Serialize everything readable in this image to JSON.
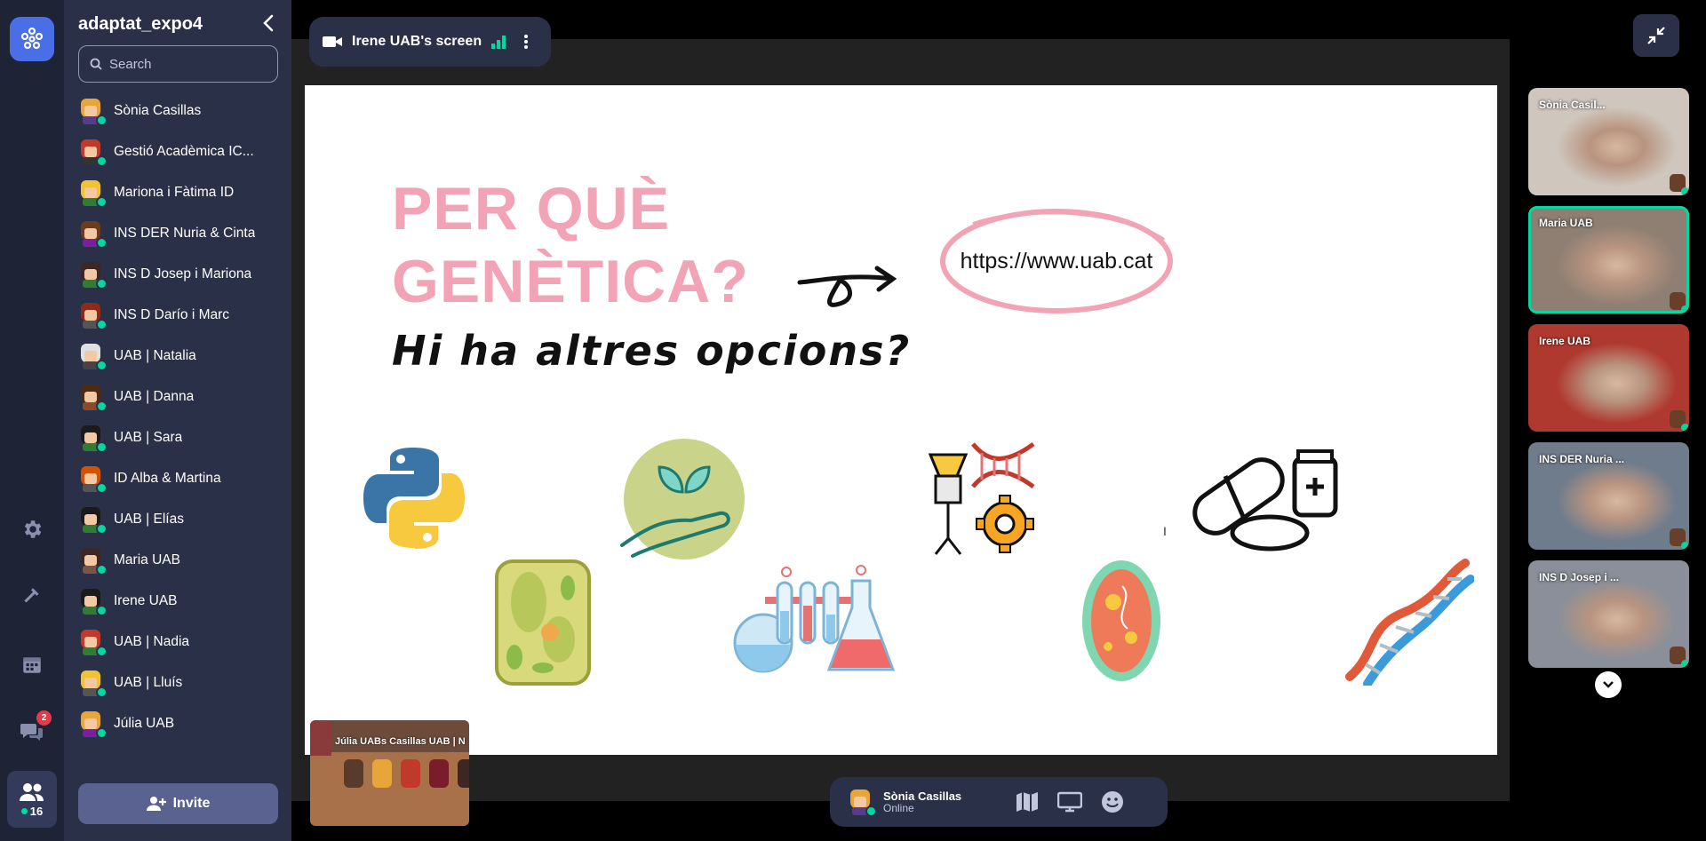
{
  "app": {
    "space_name": "adaptat_expo4"
  },
  "search": {
    "placeholder": "Search"
  },
  "users": [
    {
      "name": "Sònia Casillas",
      "hair": "#e8a53a",
      "shirt": "#5a3a8a"
    },
    {
      "name": "Gestió Acadèmica IC...",
      "hair": "#c0392b",
      "shirt": "#333"
    },
    {
      "name": "Mariona i Fàtima ID",
      "hair": "#f1c232",
      "shirt": "#2e7d32"
    },
    {
      "name": "INS DER Nuria & Cinta",
      "hair": "#6d3b1f",
      "shirt": "#7b1fa2"
    },
    {
      "name": "INS D Josep i Mariona",
      "hair": "#3e2723",
      "shirt": "#2e7d32"
    },
    {
      "name": "INS D Darío i Marc",
      "hair": "#8d2a1a",
      "shirt": "#555"
    },
    {
      "name": "UAB | Natalia",
      "hair": "#e0e0e0",
      "shirt": "#444"
    },
    {
      "name": "UAB | Danna",
      "hair": "#4e2a12",
      "shirt": "#8a4b2a"
    },
    {
      "name": "UAB | Sara",
      "hair": "#1a1a1a",
      "shirt": "#2e7d32"
    },
    {
      "name": "ID Alba & Martina",
      "hair": "#d35400",
      "shirt": "#555"
    },
    {
      "name": "UAB | Elías",
      "hair": "#1a1a1a",
      "shirt": "#2e7d32"
    },
    {
      "name": "Maria UAB",
      "hair": "#3e2723",
      "shirt": "#795548"
    },
    {
      "name": "Irene UAB",
      "hair": "#1a1a1a",
      "shirt": "#2e7d32"
    },
    {
      "name": "UAB | Nadia",
      "hair": "#c0392b",
      "shirt": "#2e7d32"
    },
    {
      "name": "UAB | Lluís",
      "hair": "#f1c232",
      "shirt": "#555"
    },
    {
      "name": "Júlia UAB",
      "hair": "#e8a53a",
      "shirt": "#7b1fa2"
    }
  ],
  "invite_label": "Invite",
  "rail": {
    "people_count": "16",
    "chat_badge": "2"
  },
  "screen_share": {
    "label": "Irene UAB's screen",
    "slide": {
      "title_line1": "PER QUÈ",
      "title_line2": "GENÈTICA?",
      "subtitle": "Hi ha altres opcions?",
      "url": "https://www.uab.cat"
    }
  },
  "pip": {
    "names": "Júlia UABs Casillas  UAB | N"
  },
  "self": {
    "name": "Sònia Casillas",
    "status": "Online"
  },
  "video_tiles": [
    {
      "name": "Sònia Casil...",
      "bg": "#cfc7bd",
      "active": false
    },
    {
      "name": "Maria UAB",
      "bg": "#8e7f72",
      "active": true
    },
    {
      "name": "Irene UAB",
      "bg": "#b0392f",
      "active": false
    },
    {
      "name": "INS DER Nuria ...",
      "bg": "#6f7c8c",
      "active": false
    },
    {
      "name": "INS D Josep i ...",
      "bg": "#8a8f99",
      "active": false
    }
  ],
  "colors": {
    "accent": "#06d6a0",
    "panel": "#2b3049",
    "rail": "#1f2336",
    "slide_pink": "#f2a4b6"
  }
}
